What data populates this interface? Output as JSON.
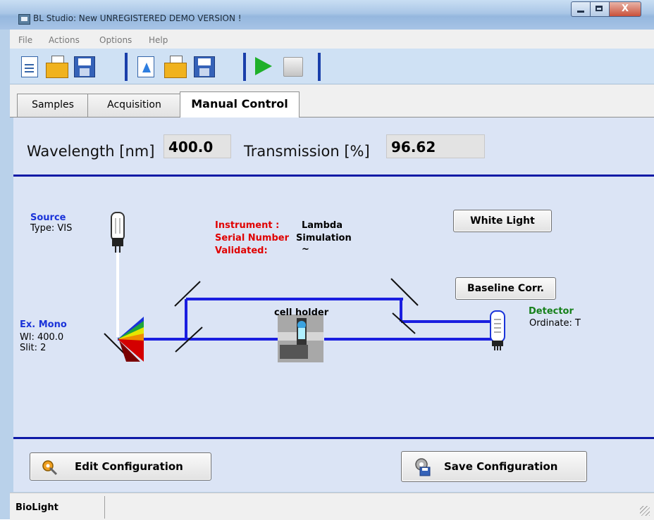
{
  "window": {
    "title": "BL Studio: New  UNREGISTERED DEMO VERSION !",
    "close_glyph": "X",
    "titlebar_buttons": [
      "minimize-icon",
      "maximize-icon",
      "close-icon"
    ]
  },
  "menu": {
    "items": [
      "File",
      "Actions",
      "Options",
      "Help"
    ]
  },
  "toolbar": {
    "buttons": [
      {
        "icon": "new-document-icon"
      },
      {
        "icon": "open-folder-icon"
      },
      {
        "icon": "save-icon"
      },
      {
        "icon": "new-sample-flask-icon"
      },
      {
        "icon": "open-sample-folder-icon"
      },
      {
        "icon": "save-sample-icon"
      },
      {
        "icon": "run-play-icon",
        "color": "#1fb02a"
      },
      {
        "icon": "stop-icon"
      }
    ]
  },
  "tabs": [
    {
      "label": "Samples",
      "active": false
    },
    {
      "label": "Acquisition",
      "active": false
    },
    {
      "label": "Manual Control",
      "active": true
    }
  ],
  "readout": {
    "wavelength_label": "Wavelength [nm]",
    "wavelength_value": "400.0",
    "transmission_label": "Transmission [%]",
    "transmission_value": "96.62"
  },
  "diagram": {
    "source_title": "Source",
    "source_type": "Type: VIS",
    "instrument_label": "Instrument :",
    "instrument_value": "Lambda",
    "serial_label": "Serial Number",
    "serial_value": "Simulation",
    "validated_label": "Validated:",
    "validated_value": "~",
    "white_light_button": "White Light",
    "baseline_button": "Baseline Corr.",
    "cell_holder_label": "cell holder",
    "detector_title": "Detector",
    "detector_ordinate": "Ordinate:  T",
    "mono_title": "Ex. Mono",
    "mono_wl": "Wl: 400.0",
    "mono_slit": "Slit: 2",
    "beam_color": "#1a1ee0",
    "accent_line_color": "#0f1aa6"
  },
  "actions": {
    "edit_config": "Edit Configuration",
    "save_config": "Save Configuration"
  },
  "status": {
    "text": "BioLight"
  }
}
